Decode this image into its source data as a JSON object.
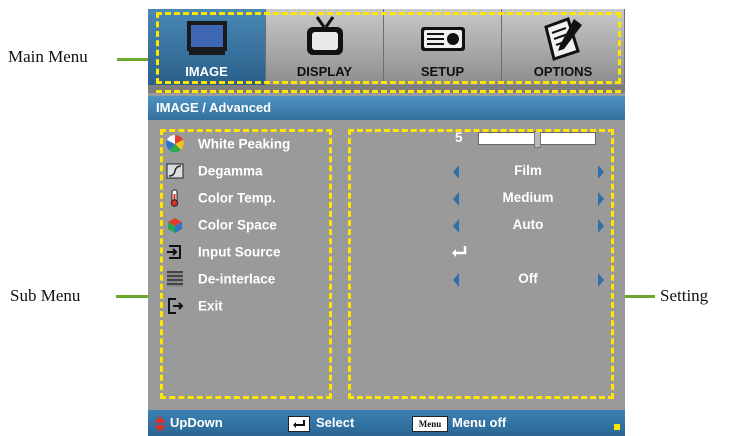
{
  "callouts": {
    "main_menu": "Main Menu",
    "sub_menu": "Sub Menu",
    "setting": "Setting"
  },
  "tabs": [
    {
      "label": "IMAGE",
      "icon": "monitor-icon",
      "active": true
    },
    {
      "label": "DISPLAY",
      "icon": "tv-icon",
      "active": false
    },
    {
      "label": "SETUP",
      "icon": "projector-icon",
      "active": false
    },
    {
      "label": "OPTIONS",
      "icon": "notepad-icon",
      "active": false
    }
  ],
  "breadcrumb": "IMAGE / Advanced",
  "submenu": [
    {
      "label": "White Peaking",
      "icon": "color-wheel-icon"
    },
    {
      "label": "Degamma",
      "icon": "gamma-curve-icon"
    },
    {
      "label": "Color Temp.",
      "icon": "thermometer-icon"
    },
    {
      "label": "Color Space",
      "icon": "color-cube-icon"
    },
    {
      "label": "Input Source",
      "icon": "input-source-icon"
    },
    {
      "label": "De-interlace",
      "icon": "deinterlace-icon"
    },
    {
      "label": "Exit",
      "icon": "exit-icon"
    }
  ],
  "settings": {
    "white_peaking_value": "5",
    "white_peaking_level": 0.5,
    "degamma": "Film",
    "color_temp": "Medium",
    "color_space": "Auto",
    "deinterlace": "Off"
  },
  "footer": {
    "updown": "UpDown",
    "select": "Select",
    "menu_chip": "Menu",
    "menu_off": "Menu off"
  },
  "colors": {
    "accent_blue": "#2f70a8",
    "highlight_yellow": "#ffe600",
    "callout_green": "#6aa82e"
  }
}
